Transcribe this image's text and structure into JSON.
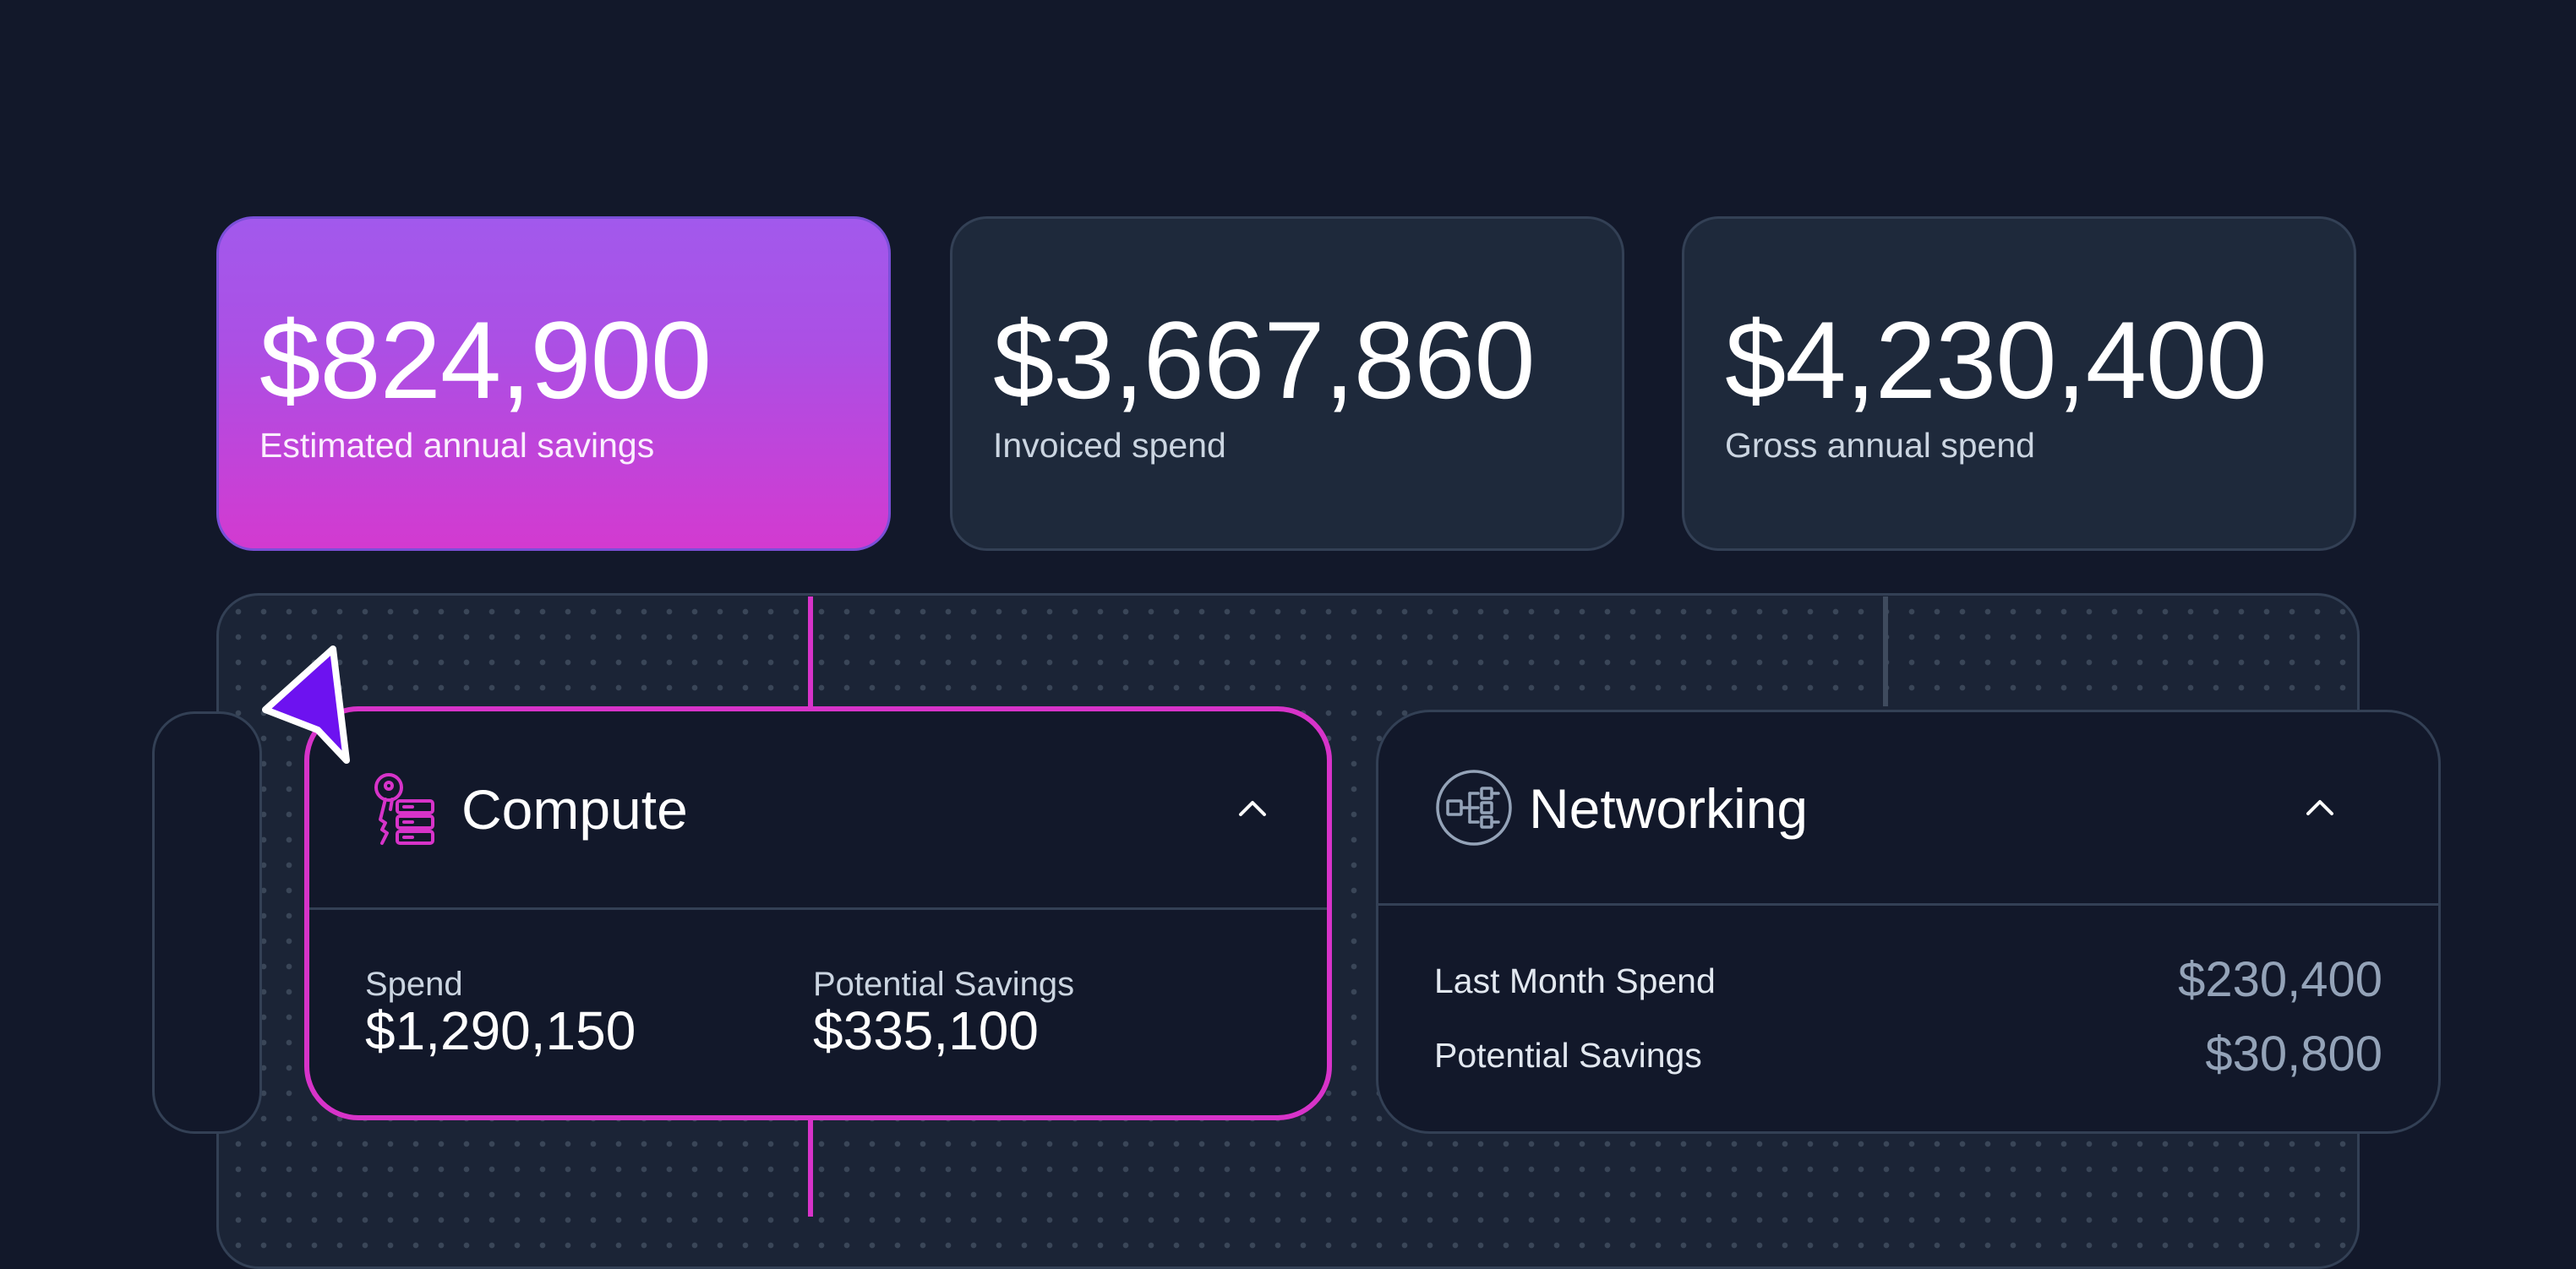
{
  "stats": [
    {
      "value": "$824,900",
      "label": "Estimated annual savings"
    },
    {
      "value": "$3,667,860",
      "label": "Invoiced spend"
    },
    {
      "value": "$4,230,400",
      "label": "Gross annual spend"
    }
  ],
  "cards": {
    "compute": {
      "title": "Compute",
      "spend_label": "Spend",
      "spend_value": "$1,290,150",
      "savings_label": "Potential Savings",
      "savings_value": "$335,100"
    },
    "networking": {
      "title": "Networking",
      "last_month_label": "Last Month Spend",
      "last_month_value": "$230,400",
      "savings_label": "Potential Savings",
      "savings_value": "$30,800"
    }
  },
  "colors": {
    "accent_pink": "#d733c9",
    "accent_purple": "#a259ec",
    "cursor": "#6d12f0",
    "background": "#12182a"
  },
  "icons": {
    "compute": "key-server-icon",
    "networking": "network-flow-icon",
    "collapse": "chevron-up-icon",
    "pointer": "cursor-pointer-icon"
  }
}
